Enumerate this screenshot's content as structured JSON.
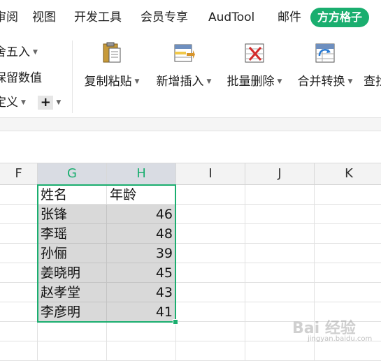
{
  "tabs": [
    {
      "label": "审阅"
    },
    {
      "label": "视图"
    },
    {
      "label": "开发工具"
    },
    {
      "label": "会员专享"
    },
    {
      "label": "AudTool"
    },
    {
      "label": "邮件"
    },
    {
      "label": "方方格子"
    }
  ],
  "ribbon_left": {
    "round": "舍五入",
    "keep_values": "保留数值",
    "custom": "定义",
    "plus": "+"
  },
  "ribbon_buttons": [
    {
      "label": "复制粘贴",
      "icon": "clipboard-paste-icon"
    },
    {
      "label": "新增插入",
      "icon": "insert-rows-icon"
    },
    {
      "label": "批量删除",
      "icon": "delete-x-icon"
    },
    {
      "label": "合并转换",
      "icon": "merge-convert-icon"
    },
    {
      "label": "查找"
    }
  ],
  "columns": [
    "F",
    "G",
    "H",
    "I",
    "J",
    "K"
  ],
  "selected_columns": [
    "G",
    "H"
  ],
  "table": {
    "headers": [
      "姓名",
      "年龄"
    ],
    "rows": [
      {
        "name": "张锋",
        "age": "46"
      },
      {
        "name": "李瑶",
        "age": "48"
      },
      {
        "name": "孙俪",
        "age": "39"
      },
      {
        "name": "姜晓明",
        "age": "45"
      },
      {
        "name": "赵孝堂",
        "age": "43"
      },
      {
        "name": "李彦明",
        "age": "41"
      }
    ]
  },
  "watermark": {
    "text": "Bai 经验",
    "sub": "jingyan.baidu.com"
  },
  "colors": {
    "accent": "#1aae6f",
    "selected_fill": "#d9d9d9"
  }
}
